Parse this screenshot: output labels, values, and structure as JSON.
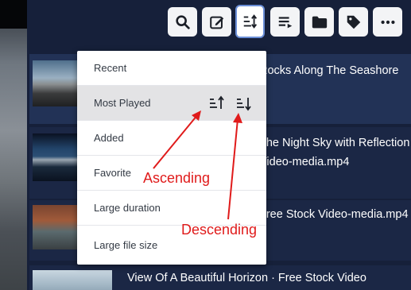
{
  "menu": {
    "items": [
      {
        "label": "Recent"
      },
      {
        "label": "Most Played"
      },
      {
        "label": "Added"
      },
      {
        "label": "Favorite"
      },
      {
        "label": "Large duration"
      },
      {
        "label": "Large file size"
      }
    ]
  },
  "videos": [
    {
      "title_line1": "Rocks Along The Seashore",
      "title_line2": ""
    },
    {
      "title_line1": "The Night Sky with Reflection",
      "title_line2": "Video-media.mp4"
    },
    {
      "title_line1": "Free Stock Video-media.mp4",
      "title_line2": ""
    },
    {
      "title_line1": "View Of A Beautiful Horizon · Free Stock Video",
      "title_line2": ""
    }
  ],
  "annotations": {
    "ascending": "Ascending",
    "descending": "Descending"
  },
  "toolbar": {
    "icons": [
      "search-icon",
      "edit-icon",
      "sort-icon",
      "playlist-icon",
      "folder-icon",
      "tag-icon",
      "more-icon"
    ]
  },
  "colors": {
    "background": "#16203a",
    "annotation": "#e01b1b",
    "accent": "#3e6fd0"
  }
}
